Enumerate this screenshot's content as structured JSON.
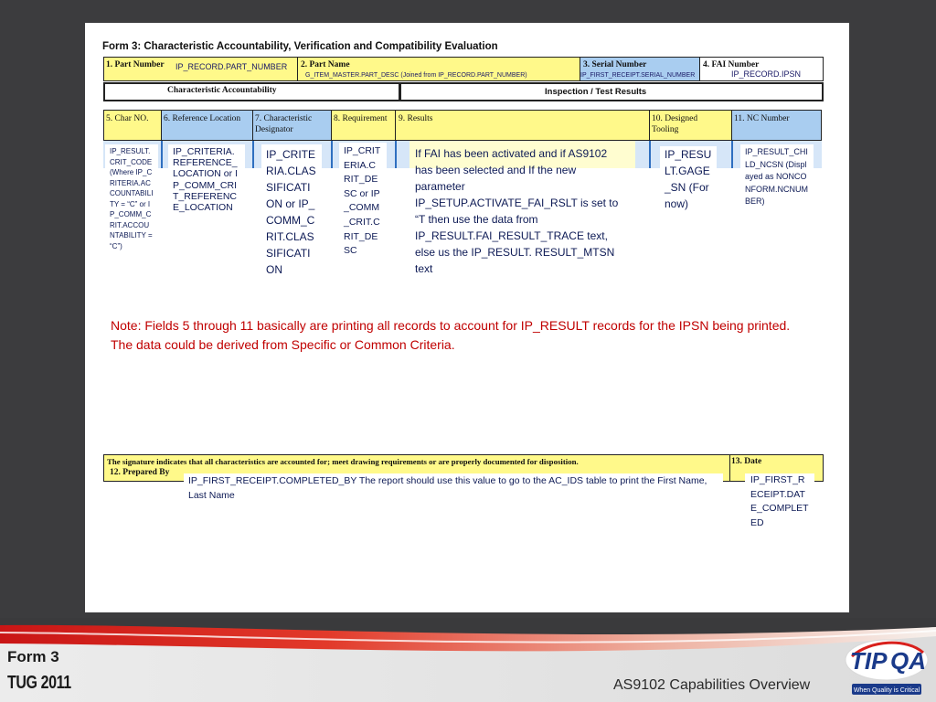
{
  "form": {
    "title": "Form 3: Characteristic Accountability, Verification and Compatibility Evaluation",
    "row1": {
      "part_number_label": "1. Part Number",
      "part_number_value": "IP_RECORD.PART_NUMBER",
      "part_name_label": "2. Part Name",
      "part_name_value": "G_ITEM_MASTER.PART_DESC (Joined from IP_RECORD.PART_NUMBER)",
      "serial_label": "3. Serial Number",
      "serial_value": "IP_FIRST_RECEIPT.SERIAL_NUMBER",
      "fai_label": "4. FAI Number",
      "fai_value": "IP_RECORD.IPSN"
    },
    "section_headers": {
      "left": "Characteristic Accountability",
      "right": "Inspection / Test Results"
    },
    "columns": [
      {
        "label": "5. Char NO."
      },
      {
        "label": "6. Reference Location"
      },
      {
        "label": "7. Characteristic Designator"
      },
      {
        "label": "8. Requirement"
      },
      {
        "label": "9. Results"
      },
      {
        "label": "10. Designed Tooling"
      },
      {
        "label": "11. NC  Number"
      }
    ],
    "data_cells": {
      "char_no": "IP_RESULT.CRIT_CODE (Where IP_CRITERIA.ACCOUNTABILITY = “C” or IP_COMM_CRIT.ACCOUNTABILITY = “C”)",
      "reference": "IP_CRITERIA.REFERENCE_LOCATION or IP_COMM_CRIT_REFERENCE_LOCATION",
      "designator": "IP_CRITERIA.CLASSIFICATION or IP_COMM_CRIT.CLASSIFICATION",
      "requirement": "IP_CRITERIA.CRIT_DESC or IP_COMM_CRIT.CRIT_DESC",
      "results": "If FAI has been activated and if AS9102 has been selected and If the new parameter IP_SETUP.ACTIVATE_FAI_RSLT is set to “T then use the data from IP_RESULT.FAI_RESULT_TRACE text, else us the IP_RESULT. RESULT_MTSN text",
      "tooling": "IP_RESULT.GAGE_SN (For now)",
      "nc_number": "IP_RESULT_CHILD_NCSN (Displayed as NONCONFORM.NCNUMBER)"
    },
    "note": "Note: Fields 5 through 11 basically are printing all records to account for IP_RESULT records for the IPSN being printed.  The data could be derived from Specific or Common Criteria.",
    "signature": {
      "statement": "The signature indicates that all characteristics are accounted for; meet  drawing requirements or are properly documented for disposition.",
      "prepared_by_label": "12. Prepared By",
      "prepared_by_value": "IP_FIRST_RECEIPT.COMPLETED_BY The report should use this value to go to the AC_IDS table to print the First Name, Last Name",
      "date_label": "13. Date",
      "date_value": "IP_FIRST_RECEIPT.DATE_COMPLETED"
    }
  },
  "footer": {
    "form_label": "Form 3",
    "event_label": "TUG 2011",
    "title": "AS9102 Capabilities Overview",
    "logo_text": "TIP QA",
    "logo_tagline": "When Quality is Critical"
  },
  "colors": {
    "yellow": "#fff98a",
    "blue": "#a9cdf0",
    "note_red": "#c00000",
    "footer_red": "#d8201c"
  }
}
